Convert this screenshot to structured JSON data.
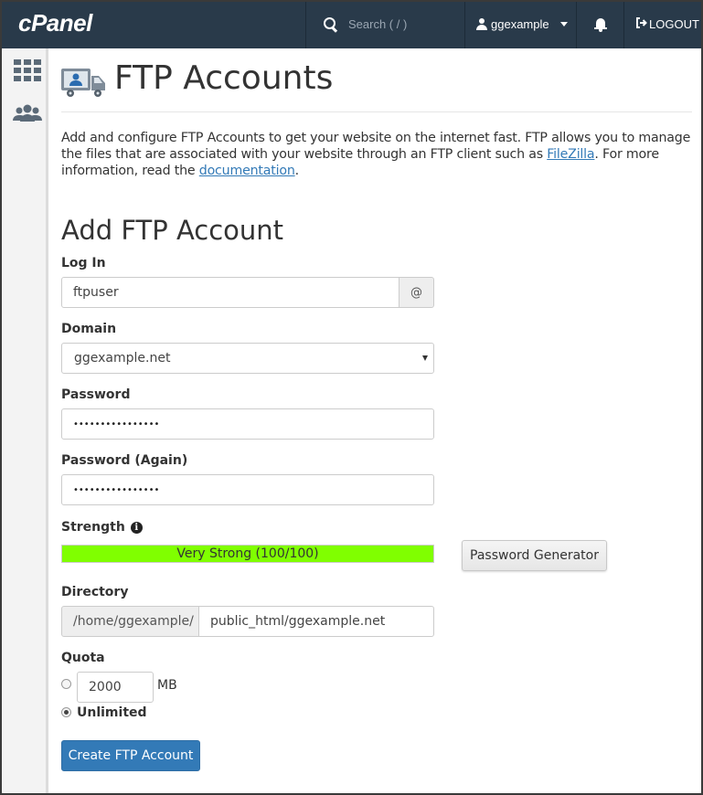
{
  "header": {
    "logo": "cPanel",
    "search_placeholder": "Search ( / )",
    "username": "ggexample",
    "logout_label": "LOGOUT"
  },
  "sidebar": {
    "items": [
      {
        "icon": "grid-icon",
        "name": "home"
      },
      {
        "icon": "users-icon",
        "name": "user-manager"
      }
    ]
  },
  "page": {
    "title": "FTP Accounts",
    "intro_part1": "Add and configure FTP Accounts to get your website on the internet fast. FTP allows you to manage the files that are associated with your website through an FTP client such as ",
    "filezilla_link": "FileZilla",
    "intro_part2": ". For more information, read the ",
    "documentation_link": "documentation",
    "intro_part3": "."
  },
  "form": {
    "section_title": "Add FTP Account",
    "login_label": "Log In",
    "login_value": "ftpuser",
    "at_sign": "@",
    "domain_label": "Domain",
    "domain_value": "ggexample.net",
    "password_label": "Password",
    "password_value": "••••••••••••••••",
    "password_again_label": "Password (Again)",
    "password_again_value": "••••••••••••••••",
    "strength_label": "Strength",
    "strength_text": "Very Strong (100/100)",
    "strength_score": 100,
    "strength_color": "#80ff00",
    "password_generator_label": "Password Generator",
    "directory_label": "Directory",
    "directory_prefix": "/home/ggexample/",
    "directory_value": "public_html/ggexample.net",
    "quota_label": "Quota",
    "quota_value": "2000",
    "quota_unit": "MB",
    "quota_unlimited_label": "Unlimited",
    "quota_selected": "unlimited",
    "submit_label": "Create FTP Account"
  }
}
